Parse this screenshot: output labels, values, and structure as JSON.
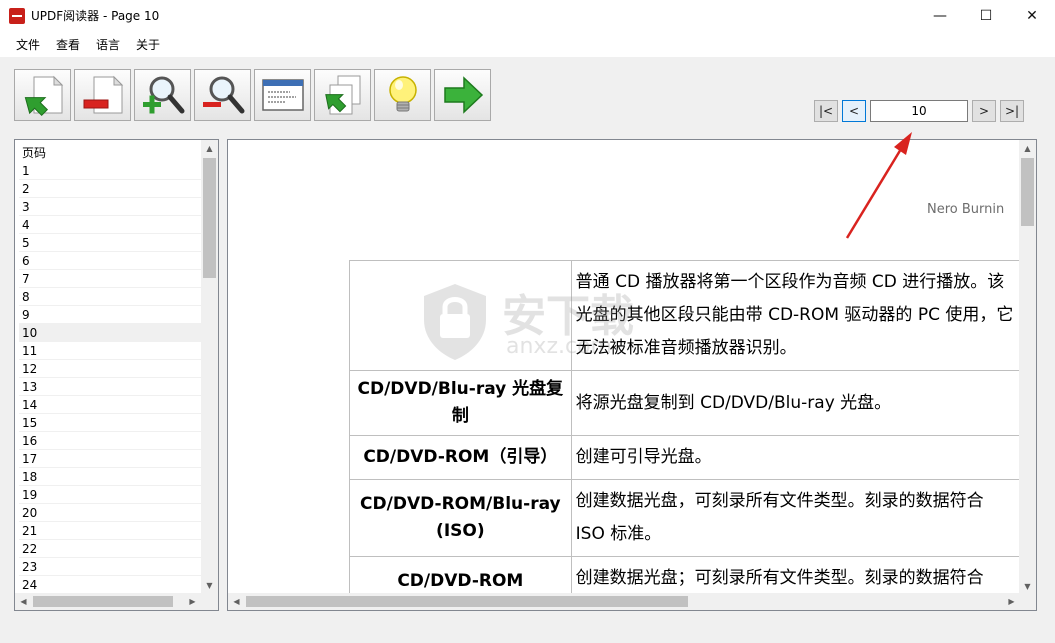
{
  "window": {
    "title": "UPDF阅读器 - Page 10",
    "minimize_glyph": "—",
    "maximize_glyph": "☐",
    "close_glyph": "✕"
  },
  "menu": [
    "文件",
    "查看",
    "语言",
    "关于"
  ],
  "toolbar": {
    "buttons": [
      {
        "name": "open-file-button",
        "icon": "open-document-green-arrow-icon"
      },
      {
        "name": "close-file-button",
        "icon": "close-document-red-bar-icon"
      },
      {
        "name": "zoom-in-button",
        "icon": "zoom-in-magnifier-icon"
      },
      {
        "name": "zoom-out-button",
        "icon": "zoom-out-magnifier-icon"
      },
      {
        "name": "window-view-button",
        "icon": "window-icon"
      },
      {
        "name": "copy-export-button",
        "icon": "copy-document-arrow-icon"
      },
      {
        "name": "tips-button",
        "icon": "lightbulb-icon"
      },
      {
        "name": "go-button",
        "icon": "green-right-arrow-icon"
      }
    ]
  },
  "pager": {
    "first": "|<",
    "prev": "<",
    "current_page": "10",
    "next": ">",
    "last": ">|"
  },
  "page_list": {
    "header": "页码",
    "selected": "10",
    "items": [
      "1",
      "2",
      "3",
      "4",
      "5",
      "6",
      "7",
      "8",
      "9",
      "10",
      "11",
      "12",
      "13",
      "14",
      "15",
      "16",
      "17",
      "18",
      "19",
      "20",
      "21",
      "22",
      "23",
      "24"
    ]
  },
  "document": {
    "header_text": "Nero Burnin",
    "watermark_text": "安下载",
    "watermark_sub": "anxz.com",
    "rows": [
      {
        "c1": "",
        "c2": "普通 CD 播放器将第一个区段作为音频 CD 进行播放。该光盘的其他区段只能由带 CD-ROM 驱动器的 PC 使用，它无法被标准音频播放器识别。",
        "c2_bold": false
      },
      {
        "c1": "CD/DVD/Blu-ray 光盘复制",
        "c2": "将源光盘复制到 CD/DVD/Blu-ray 光盘。",
        "c2_bold": false
      },
      {
        "c1": "CD/DVD-ROM（引导）",
        "c2": "创建可引导光盘。",
        "c2_bold": false
      },
      {
        "c1": "CD/DVD-ROM/Blu-ray (ISO)",
        "c2": "创建数据光盘，可刻录所有文件类型。刻录的数据符合 ISO 标准。",
        "c2_bold": false
      },
      {
        "c1": "CD/DVD-ROM (UDF/ISO)",
        "c2": "创建数据光盘；可刻录所有文件类型。刻录的数据符合 UDF 标准。",
        "c2_bold": false
      }
    ]
  },
  "colors": {
    "accent_blue": "#0078d7",
    "title_icon_red": "#c8201a",
    "annotation_arrow": "#d9231f"
  }
}
